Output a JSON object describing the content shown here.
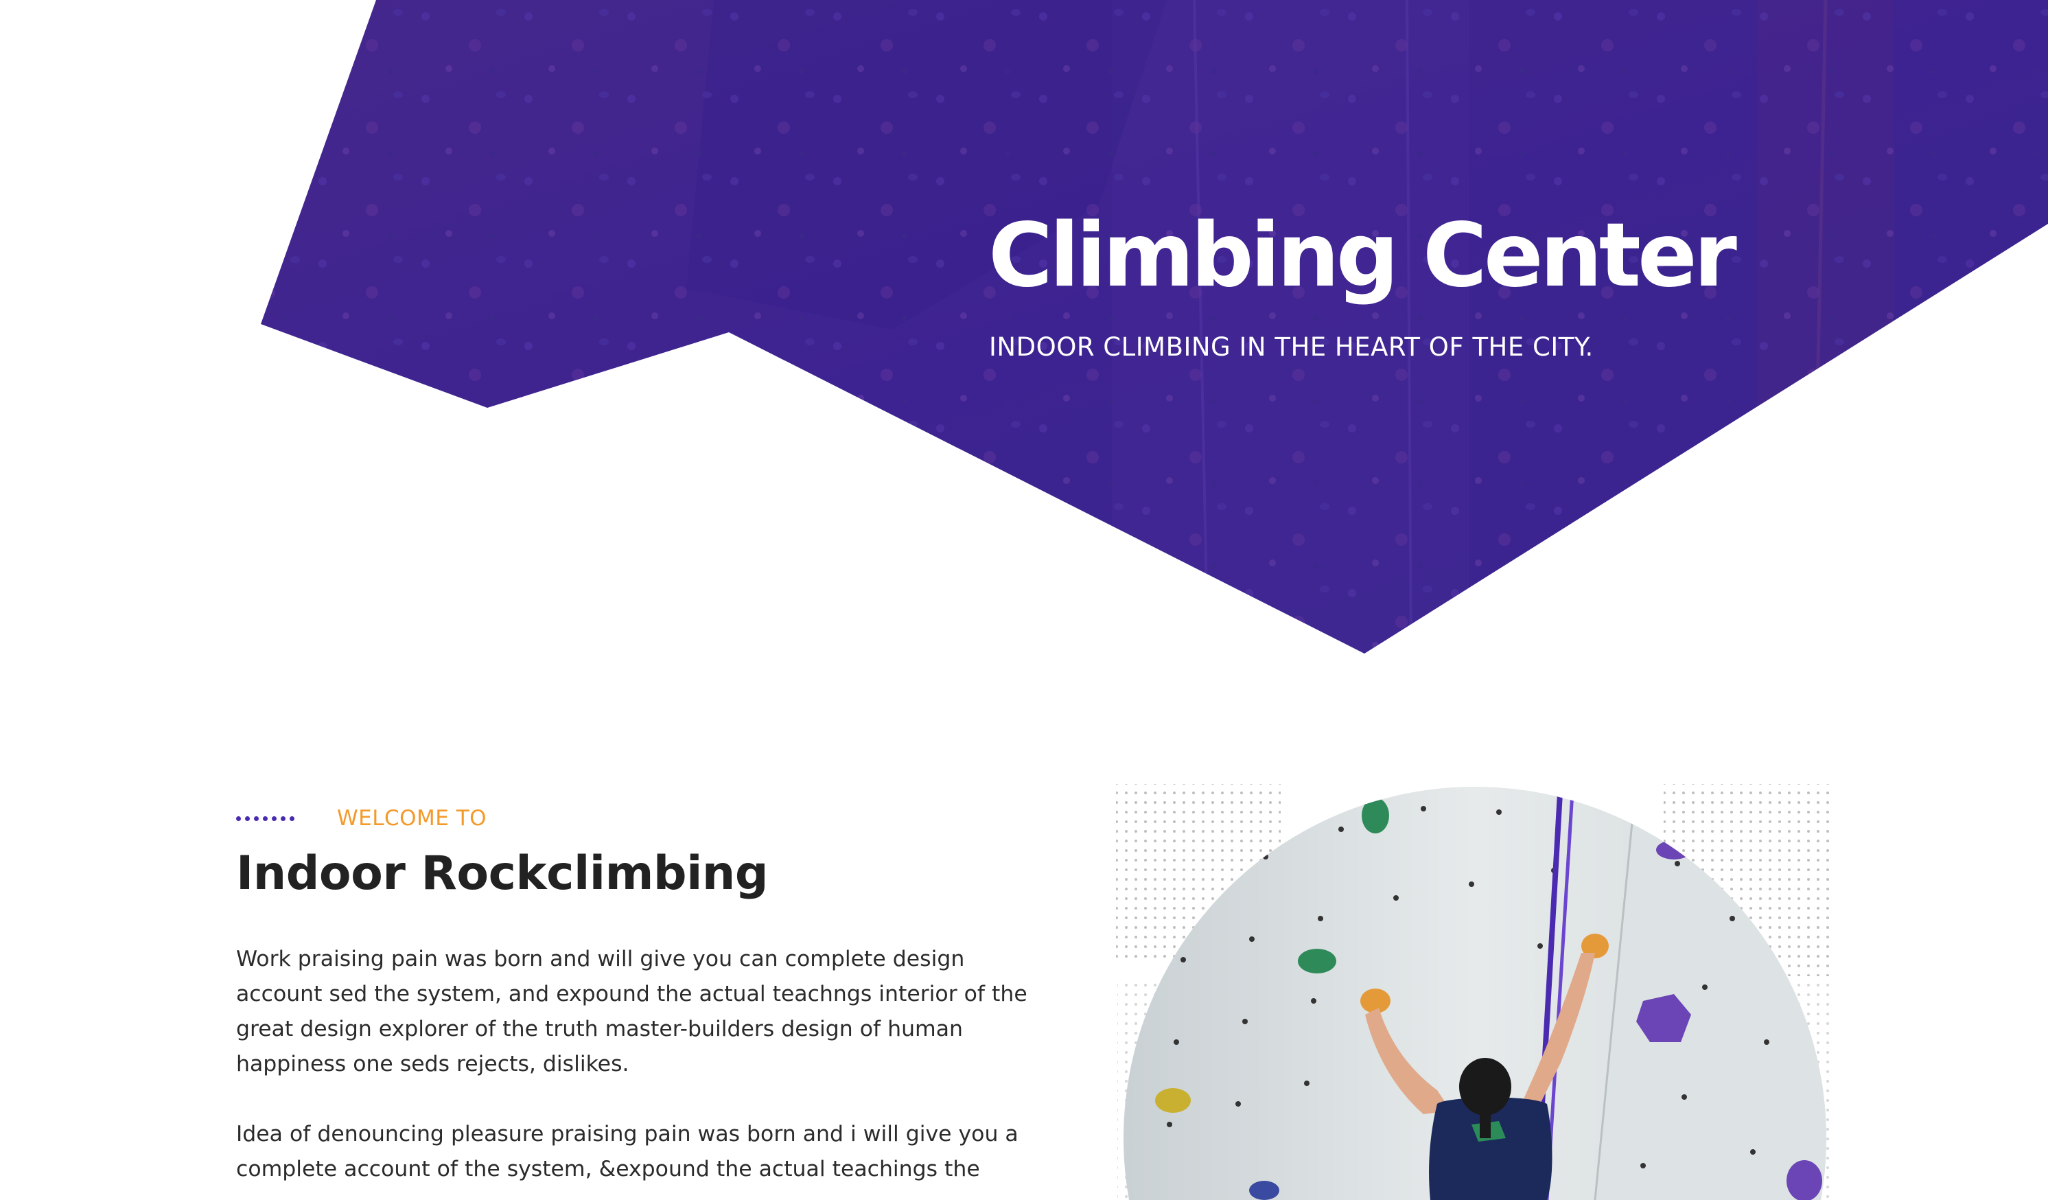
{
  "hero": {
    "title": "Climbing Center",
    "subtitle": "INDOOR CLIMBING IN THE HEART OF THE CITY."
  },
  "intro": {
    "eyebrow": "WELCOME TO",
    "heading": "Indoor Rockclimbing",
    "paragraph1": "Work praising pain was born and will give you can complete design account sed the system, and expound the actual teachngs interior of the great design explorer of the truth master-builders design of human happiness one seds rejects, dislikes.",
    "paragraph2": "Idea of denouncing pleasure praising pain was born and i will give you a complete account of the system, &expound the actual teachings the"
  },
  "colors": {
    "hero_overlay": "#3b2290",
    "accent_orange": "#f39a2b",
    "accent_purple": "#4a2ab0",
    "heading_dark": "#222222"
  }
}
